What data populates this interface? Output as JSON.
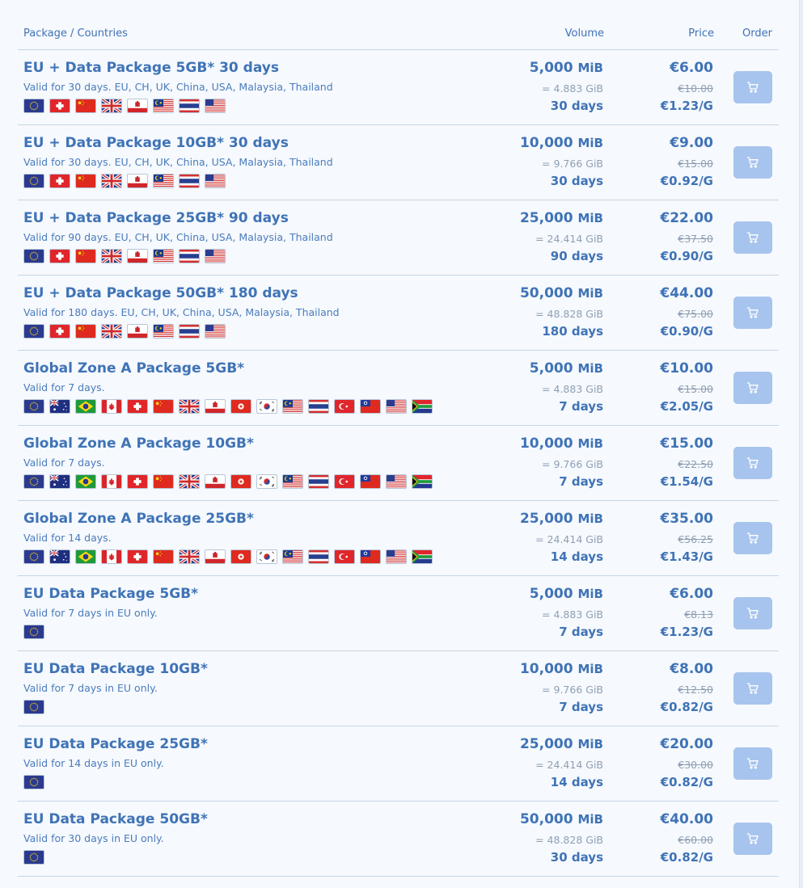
{
  "header": {
    "package_countries": "Package / Countries",
    "volume": "Volume",
    "price": "Price",
    "order": "Order"
  },
  "colors": {
    "text_primary": "#3f73b6",
    "text_muted": "#8f9fb4",
    "cart_button": "#a7c4ee",
    "divider": "#c5d5e8",
    "background": "#f6f9fd"
  },
  "packages": [
    {
      "name": "EU + Data Package 5GB* 30 days",
      "desc": "Valid for 30 days. EU, CH, UK, China, USA, Malaysia, Thailand",
      "flags": [
        "eu",
        "ch",
        "cn",
        "uk",
        "gi",
        "my",
        "th",
        "us"
      ],
      "vol": "5,000",
      "unit": "MiB",
      "gib": "= 4.883 GiB",
      "days": "30 days",
      "price": "€6.00",
      "old": "€10.00",
      "pergb": "€1.23/G"
    },
    {
      "name": "EU + Data Package 10GB* 30 days",
      "desc": "Valid for 30 days. EU, CH, UK, China, USA, Malaysia, Thailand",
      "flags": [
        "eu",
        "ch",
        "cn",
        "uk",
        "gi",
        "my",
        "th",
        "us"
      ],
      "vol": "10,000",
      "unit": "MiB",
      "gib": "= 9.766 GiB",
      "days": "30 days",
      "price": "€9.00",
      "old": "€15.00",
      "pergb": "€0.92/G"
    },
    {
      "name": "EU + Data Package 25GB* 90 days",
      "desc": "Valid for 90 days. EU, CH, UK, China, USA, Malaysia, Thailand",
      "flags": [
        "eu",
        "ch",
        "cn",
        "uk",
        "gi",
        "my",
        "th",
        "us"
      ],
      "vol": "25,000",
      "unit": "MiB",
      "gib": "= 24.414 GiB",
      "days": "90 days",
      "price": "€22.00",
      "old": "€37.50",
      "pergb": "€0.90/G"
    },
    {
      "name": "EU + Data Package 50GB* 180 days",
      "desc": "Valid for 180 days. EU, CH, UK, China, USA, Malaysia, Thailand",
      "flags": [
        "eu",
        "ch",
        "cn",
        "uk",
        "gi",
        "my",
        "th",
        "us"
      ],
      "vol": "50,000",
      "unit": "MiB",
      "gib": "= 48.828 GiB",
      "days": "180 days",
      "price": "€44.00",
      "old": "€75.00",
      "pergb": "€0.90/G"
    },
    {
      "name": "Global Zone A Package 5GB*",
      "desc": "Valid for 7 days.",
      "flags": [
        "eu",
        "au",
        "br",
        "ca",
        "ch",
        "cn",
        "uk",
        "gi",
        "hk",
        "kr",
        "my",
        "th",
        "tr",
        "tw",
        "us",
        "za"
      ],
      "vol": "5,000",
      "unit": "MiB",
      "gib": "= 4.883 GiB",
      "days": "7 days",
      "price": "€10.00",
      "old": "€15.00",
      "pergb": "€2.05/G"
    },
    {
      "name": "Global Zone A Package 10GB*",
      "desc": "Valid for 7 days.",
      "flags": [
        "eu",
        "au",
        "br",
        "ca",
        "ch",
        "cn",
        "uk",
        "gi",
        "hk",
        "kr",
        "my",
        "th",
        "tr",
        "tw",
        "us",
        "za"
      ],
      "vol": "10,000",
      "unit": "MiB",
      "gib": "= 9.766 GiB",
      "days": "7 days",
      "price": "€15.00",
      "old": "€22.50",
      "pergb": "€1.54/G"
    },
    {
      "name": "Global Zone A Package 25GB*",
      "desc": "Valid for 14 days.",
      "flags": [
        "eu",
        "au",
        "br",
        "ca",
        "ch",
        "cn",
        "uk",
        "gi",
        "hk",
        "kr",
        "my",
        "th",
        "tr",
        "tw",
        "us",
        "za"
      ],
      "vol": "25,000",
      "unit": "MiB",
      "gib": "= 24.414 GiB",
      "days": "14 days",
      "price": "€35.00",
      "old": "€56.25",
      "pergb": "€1.43/G"
    },
    {
      "name": "EU Data Package 5GB*",
      "desc": "Valid for 7 days in EU only.",
      "flags": [
        "eu"
      ],
      "vol": "5,000",
      "unit": "MiB",
      "gib": "= 4.883 GiB",
      "days": "7 days",
      "price": "€6.00",
      "old": "€8.13",
      "pergb": "€1.23/G"
    },
    {
      "name": "EU Data Package 10GB*",
      "desc": "Valid for 7 days in EU only.",
      "flags": [
        "eu"
      ],
      "vol": "10,000",
      "unit": "MiB",
      "gib": "= 9.766 GiB",
      "days": "7 days",
      "price": "€8.00",
      "old": "€12.50",
      "pergb": "€0.82/G"
    },
    {
      "name": "EU Data Package 25GB*",
      "desc": "Valid for 14 days in EU only.",
      "flags": [
        "eu"
      ],
      "vol": "25,000",
      "unit": "MiB",
      "gib": "= 24.414 GiB",
      "days": "14 days",
      "price": "€20.00",
      "old": "€30.00",
      "pergb": "€0.82/G"
    },
    {
      "name": "EU Data Package 50GB*",
      "desc": "Valid for 30 days in EU only.",
      "flags": [
        "eu"
      ],
      "vol": "50,000",
      "unit": "MiB",
      "gib": "= 48.828 GiB",
      "days": "30 days",
      "price": "€40.00",
      "old": "€60.00",
      "pergb": "€0.82/G"
    }
  ]
}
